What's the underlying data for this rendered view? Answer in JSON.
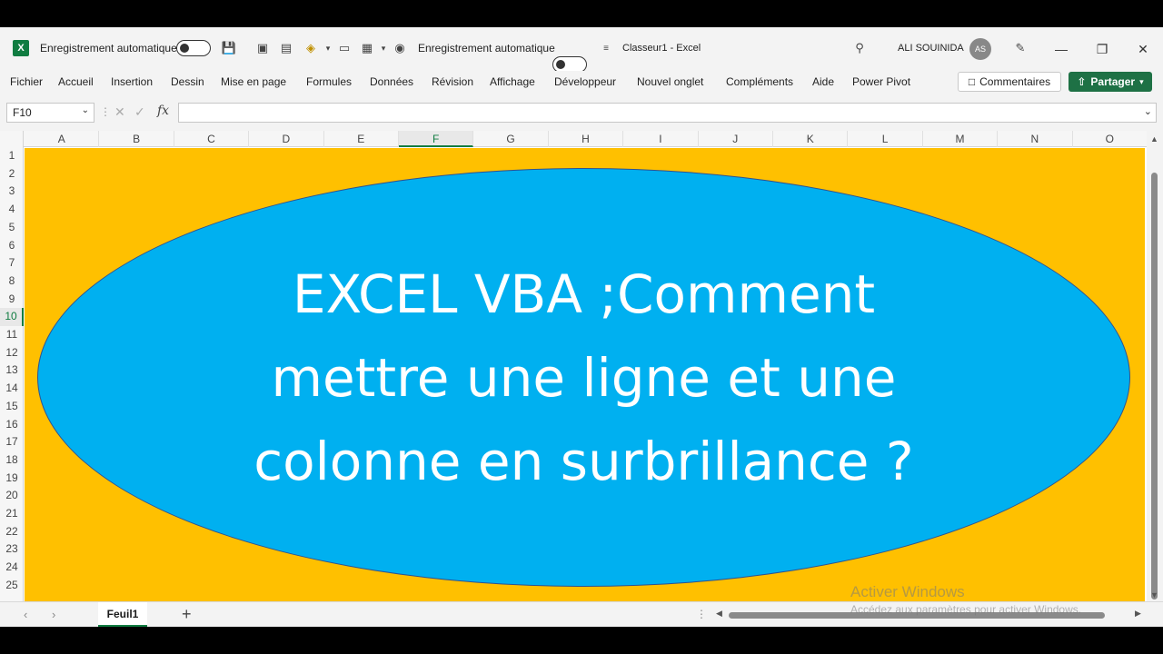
{
  "app": {
    "window_title": "Classeur1  -  Excel",
    "autosave_label": "Enregistrement automatique",
    "user_name": "ALI SOUINIDA",
    "user_initials": "AS"
  },
  "menu": {
    "items": [
      "Fichier",
      "Accueil",
      "Insertion",
      "Dessin",
      "Mise en page",
      "Formules",
      "Données",
      "Révision",
      "Affichage",
      "Développeur",
      "Nouvel onglet",
      "Compléments",
      "Aide",
      "Power Pivot"
    ],
    "comments_label": "Commentaires",
    "share_label": "Partager"
  },
  "formula_bar": {
    "name_box": "F10",
    "fx": "fx",
    "value": ""
  },
  "grid": {
    "columns": [
      "A",
      "B",
      "C",
      "D",
      "E",
      "F",
      "G",
      "H",
      "I",
      "J",
      "K",
      "L",
      "M",
      "N",
      "O"
    ],
    "rows": [
      "1",
      "2",
      "3",
      "4",
      "5",
      "6",
      "7",
      "8",
      "9",
      "10",
      "11",
      "12",
      "13",
      "14",
      "15",
      "16",
      "17",
      "18",
      "19",
      "20",
      "21",
      "22",
      "23",
      "24",
      "25"
    ],
    "active_column": "F",
    "active_row": "10"
  },
  "shape": {
    "line1": "EXCEL VBA ;Comment",
    "line2": "mettre une ligne et une",
    "line3": "colonne en surbrillance ?",
    "fill_color": "#00b0f0",
    "background_color": "#ffc000"
  },
  "sheets": {
    "tabs": [
      "Feuil1"
    ],
    "add_label": "+"
  },
  "watermark": {
    "title": "Activer Windows",
    "subtitle": "Accédez aux paramètres pour activer Windows."
  }
}
